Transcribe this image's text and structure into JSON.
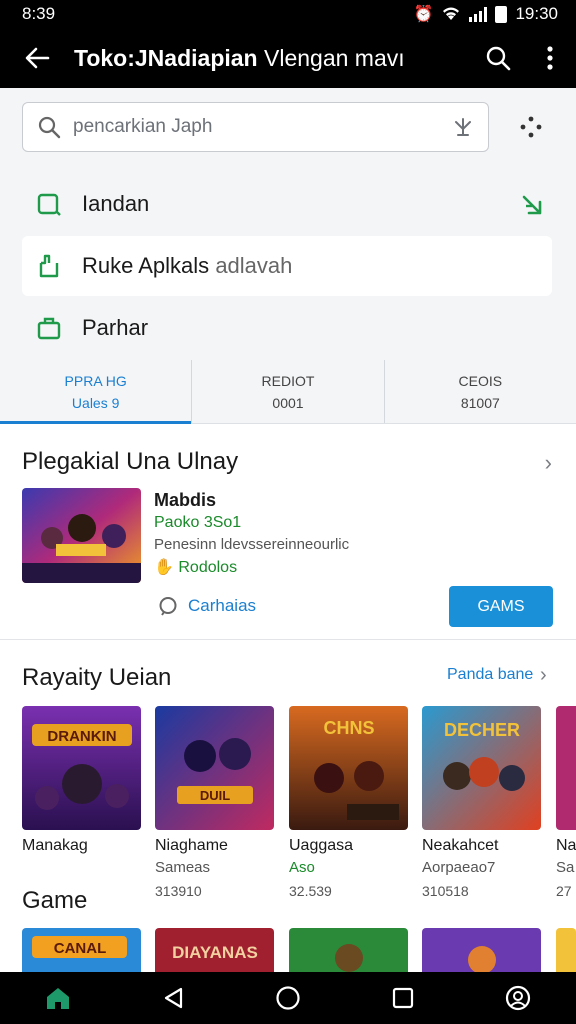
{
  "status": {
    "left_time": "8:39",
    "right_time": "19:30"
  },
  "appbar": {
    "title_bold": "Toko:JNadiapian",
    "title_rest": "Vlengan mavı"
  },
  "search": {
    "placeholder": "pencarkian Japh"
  },
  "menu": [
    {
      "label": "Iandan"
    },
    {
      "label": "Ruke Aplkals",
      "label_rest": "adlavah"
    },
    {
      "label": "Parhar"
    }
  ],
  "tabs": [
    {
      "label": "PPRA HG",
      "value": "Uales 9"
    },
    {
      "label": "REDIOT",
      "value": "0001"
    },
    {
      "label": "CEOIS",
      "value": "81007"
    }
  ],
  "featured": {
    "heading": "Plegakial Una Ulnay",
    "name": "Mabdis",
    "price": "Paoko 3So1",
    "desc": "Penesinn ldevssereinneourlic",
    "rating": "Rodolos",
    "comments": "Carhaias",
    "button": "GAMS"
  },
  "popular": {
    "heading": "Rayaity Ueian",
    "more": "Panda bane",
    "items": [
      {
        "name": "Manakag",
        "sub": "",
        "num": "",
        "art": "DRANKIN"
      },
      {
        "name": "Niaghame",
        "sub": "Sameas",
        "num": "313910",
        "art": "DUIL"
      },
      {
        "name": "Uaggasa",
        "sub": "Aso",
        "num": "32.539",
        "art": "CHNS"
      },
      {
        "name": "Neakahcet",
        "sub": "Aorpaeao7",
        "num": "310518",
        "art": "DECHER"
      },
      {
        "name": "Na",
        "sub": "Sa",
        "num": "27",
        "art": ""
      }
    ]
  },
  "games": {
    "heading": "Game",
    "items": [
      {
        "art": "CANAL"
      },
      {
        "art": "DIAYANAS"
      },
      {
        "art": ""
      },
      {
        "art": ""
      },
      {
        "art": ""
      }
    ]
  },
  "colors": {
    "accent": "#1a90d8",
    "green": "#1a8a2a"
  }
}
